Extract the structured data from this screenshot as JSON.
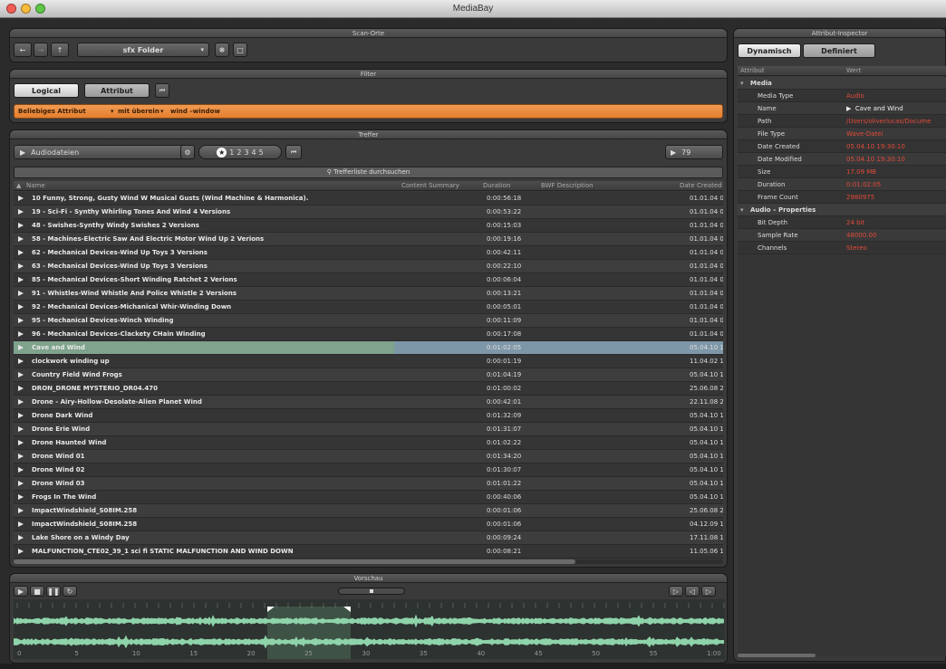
{
  "window": {
    "title": "MediaBay"
  },
  "scan": {
    "title": "Scan-Orte",
    "folder": "sfx Folder"
  },
  "filter": {
    "title": "Filter",
    "tabs": {
      "logical": "Logical",
      "attribut": "Attribut"
    },
    "condition": {
      "attribute": "Beliebiges Attribut",
      "operator": "mit überein",
      "value": "wind –window"
    }
  },
  "results": {
    "title": "Treffer",
    "type": "Audiodateien",
    "ratings": [
      "1",
      "2",
      "3",
      "4",
      "5"
    ],
    "count": "79",
    "search_placeholder": "Trefferliste durchsuchen",
    "columns": {
      "name": "Name",
      "content": "Content Summary",
      "duration": "Duration",
      "bwf": "BWF Description",
      "date": "Date Created"
    },
    "rows": [
      {
        "name": "10 Funny, Strong, Gusty Wind W Musical Gusts (Wind Machine & Harmonica).",
        "duration": "0:00:56:18",
        "date": "01.01.04 0"
      },
      {
        "name": "19 - Sci-Fi - Synthy Whirling Tones And Wind 4 Versions",
        "duration": "0:00:53:22",
        "date": "01.01.04 0"
      },
      {
        "name": "48 - Swishes-Synthy Windy Swishes 2 Versions",
        "duration": "0:00:15:03",
        "date": "01.01.04 0"
      },
      {
        "name": "58 - Machines-Electric Saw And Electric Motor Wind Up 2 Verions",
        "duration": "0:00:19:16",
        "date": "01.01.04 0"
      },
      {
        "name": "62 - Mechanical Devices-Wind Up Toys 3 Versions",
        "duration": "0:00:42:11",
        "date": "01.01.04 0"
      },
      {
        "name": "63 - Mechanical Devices-Wind Up Toys 3 Versions",
        "duration": "0:00:22:10",
        "date": "01.01.04 0"
      },
      {
        "name": "85 - Mechanical Devices-Short Winding Ratchet 2 Verions",
        "duration": "0:00:06:04",
        "date": "01.01.04 0"
      },
      {
        "name": "91 - Whistles-Wind Whistle And Police Whistle 2 Versions",
        "duration": "0:00:13:21",
        "date": "01.01.04 0"
      },
      {
        "name": "92 - Mechanical Devices-Michanical Whir-Winding Down",
        "duration": "0:00:05:01",
        "date": "01.01.04 0"
      },
      {
        "name": "95 - Mechanical Devices-Winch Winding",
        "duration": "0:00:11:09",
        "date": "01.01.04 0"
      },
      {
        "name": "96 - Mechanical Devices-Clackety CHain Winding",
        "duration": "0:00:17:08",
        "date": "01.01.04 0"
      },
      {
        "name": "Cave and Wind",
        "duration": "0:01:02:05",
        "date": "05.04.10 1"
      },
      {
        "name": "clockwork winding up",
        "duration": "0:00:01:19",
        "date": "11.04.02 1"
      },
      {
        "name": "Country Field Wind Frogs",
        "duration": "0:01:04:19",
        "date": "05.04.10 1"
      },
      {
        "name": "DRON_DRONE MYSTERIO_DR04.470",
        "duration": "0:01:00:02",
        "date": "25.06.08 2"
      },
      {
        "name": "Drone - Airy-Hollow-Desolate-Alien Planet Wind",
        "duration": "0:00:42:01",
        "date": "22.11.08 2"
      },
      {
        "name": "Drone Dark Wind",
        "duration": "0:01:32:09",
        "date": "05.04.10 1"
      },
      {
        "name": "Drone Erie Wind",
        "duration": "0:01:31:07",
        "date": "05.04.10 1"
      },
      {
        "name": "Drone Haunted Wind",
        "duration": "0:01:02:22",
        "date": "05.04.10 1"
      },
      {
        "name": "Drone Wind 01",
        "duration": "0:01:34:20",
        "date": "05.04.10 1"
      },
      {
        "name": "Drone Wind 02",
        "duration": "0:01:30:07",
        "date": "05.04.10 1"
      },
      {
        "name": "Drone Wind 03",
        "duration": "0:01:01:22",
        "date": "05.04.10 1"
      },
      {
        "name": "Frogs In The Wind",
        "duration": "0:00:40:06",
        "date": "05.04.10 1"
      },
      {
        "name": "ImpactWindshield_S08IM.258",
        "duration": "0:00:01:06",
        "date": "25.06.08 2"
      },
      {
        "name": "ImpactWindshield_S08IM.258",
        "duration": "0:00:01:06",
        "date": "04.12.09 1"
      },
      {
        "name": "Lake Shore on a Windy Day",
        "duration": "0:00:09:24",
        "date": "17.11.08 1"
      },
      {
        "name": "MALFUNCTION_CTE02_39_1 sci fi STATIC MALFUNCTION AND WIND DOWN",
        "duration": "0:00:08:21",
        "date": "11.05.06 1"
      }
    ]
  },
  "preview": {
    "title": "Vorschau",
    "ticks": [
      "0",
      "5",
      "10",
      "15",
      "20",
      "25",
      "30",
      "35",
      "40",
      "45",
      "50",
      "55",
      "1:00"
    ]
  },
  "inspector": {
    "title": "Attribut-Inspector",
    "tabs": {
      "dynamic": "Dynamisch",
      "defined": "Definiert"
    },
    "columns": {
      "attr": "Attribut",
      "value": "Wert"
    },
    "groups": [
      {
        "name": "Media",
        "items": [
          {
            "key": "Media Type",
            "value": "Audio"
          },
          {
            "key": "Name",
            "value": "Cave and Wind"
          },
          {
            "key": "Path",
            "value": "/Users/oliverlucas/Docume"
          },
          {
            "key": "File Type",
            "value": "Wave-Datei"
          },
          {
            "key": "Date Created",
            "value": "05.04.10 19:30:10"
          },
          {
            "key": "Date Modified",
            "value": "05.04.10 19:30:10"
          },
          {
            "key": "Size",
            "value": "17.09 MB"
          },
          {
            "key": "Duration",
            "value": "0:01:02:05"
          },
          {
            "key": "Frame Count",
            "value": "2980975"
          }
        ]
      },
      {
        "name": "Audio – Properties",
        "items": [
          {
            "key": "Bit Depth",
            "value": "24 bit"
          },
          {
            "key": "Sample Rate",
            "value": "48000.00"
          },
          {
            "key": "Channels",
            "value": "Stereo"
          }
        ]
      }
    ]
  },
  "colors": {
    "orange": "#e88838",
    "selected_row": "#7fa38d",
    "value_red": "#e24b3a",
    "wave_green": "#8fd3aa"
  }
}
